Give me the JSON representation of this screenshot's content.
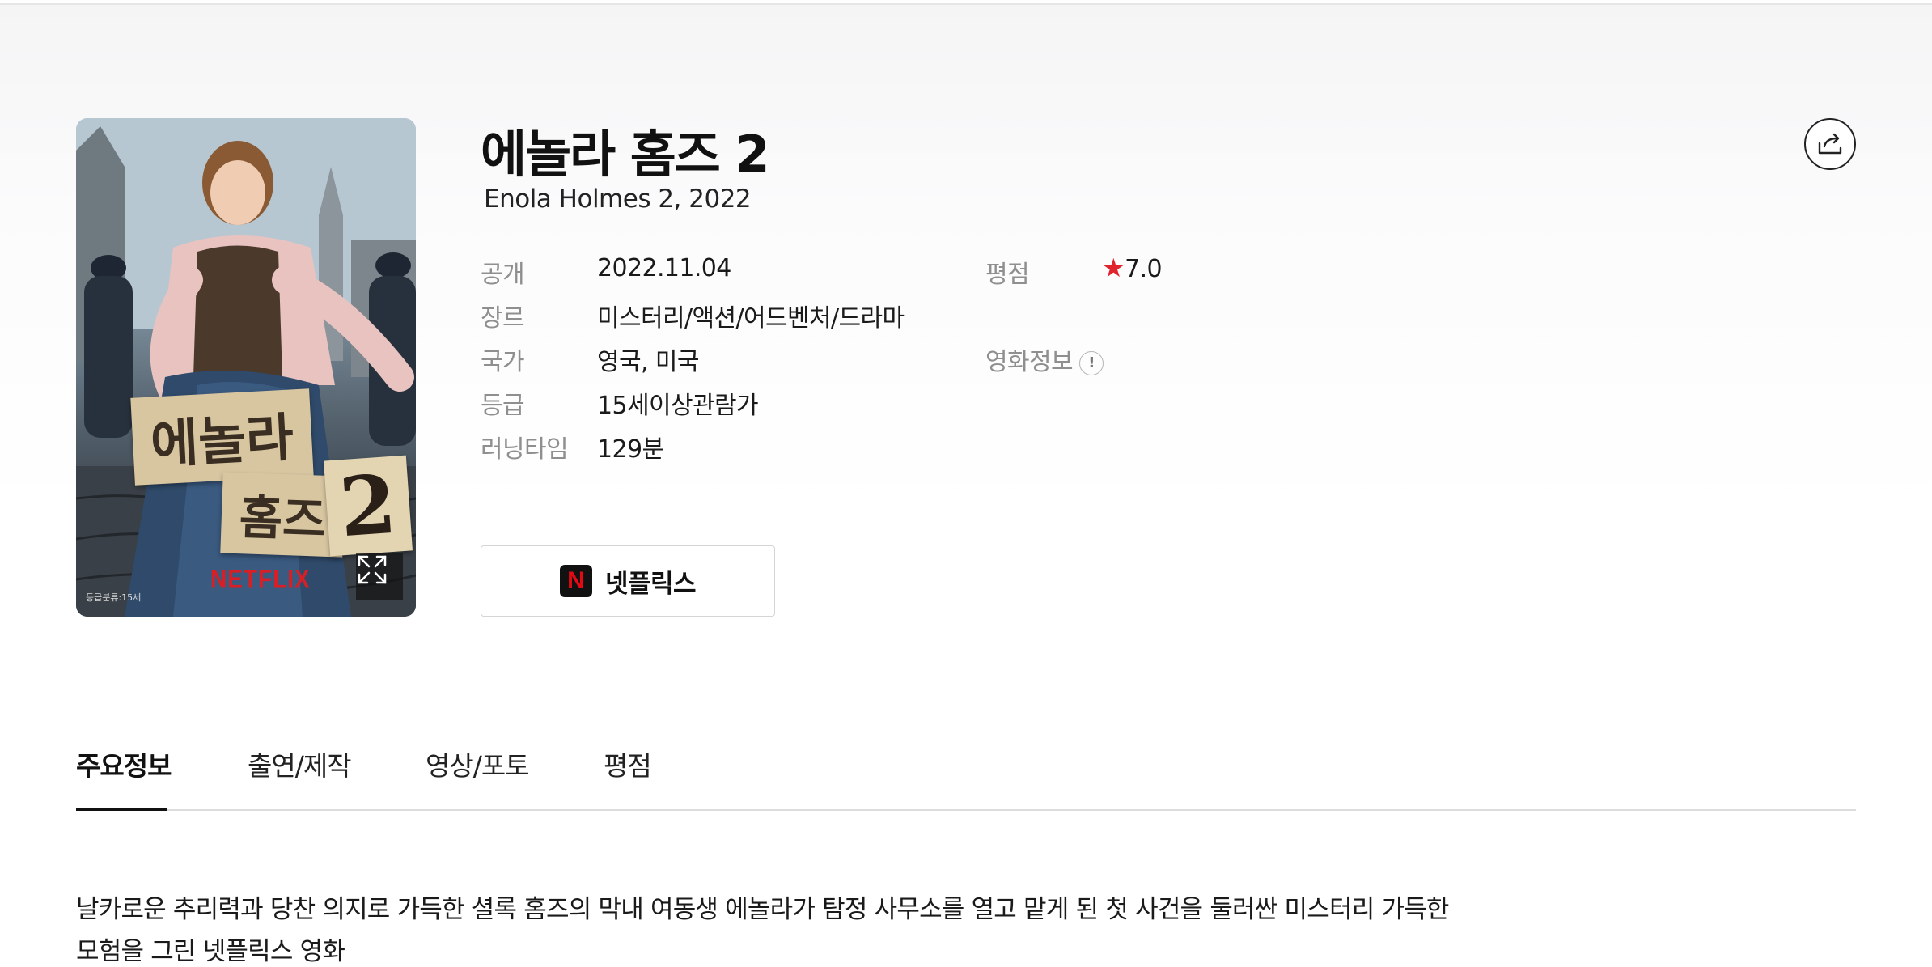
{
  "movie": {
    "title": "에놀라 홈즈 2",
    "subtitle": "Enola Holmes 2, 2022"
  },
  "poster": {
    "art_title_line1": "에놀라",
    "art_title_line2": "홈즈",
    "art_title_number": "2",
    "studio_mark": "NETFLIX",
    "rating_mark": "등급분류:15세",
    "expand_icon": "expand-icon"
  },
  "details": {
    "release_label": "공개",
    "release_value": "2022.11.04",
    "genre_label": "장르",
    "genre_value": "미스터리/액션/어드벤처/드라마",
    "country_label": "국가",
    "country_value": "영국, 미국",
    "grade_label": "등급",
    "grade_value": "15세이상관람가",
    "runtime_label": "러닝타임",
    "runtime_value": "129분",
    "score_label": "평점",
    "score_star": "★",
    "score_value": "7.0",
    "movieinfo_label": "영화정보",
    "movieinfo_badge": "!"
  },
  "watch": {
    "logo_letter": "N",
    "label": "넷플릭스"
  },
  "tabs": [
    {
      "label": "주요정보",
      "active": true
    },
    {
      "label": "출연/제작",
      "active": false
    },
    {
      "label": "영상/포토",
      "active": false
    },
    {
      "label": "평점",
      "active": false
    }
  ],
  "synopsis": "날카로운 추리력과 당찬 의지로 가득한 셜록 홈즈의 막내 여동생 에놀라가 탐정 사무소를 열고 맡게 된 첫 사건을 둘러싼 미스터리 가득한 모험을 그린 넷플릭스 영화",
  "colors": {
    "accent_star": "#e0242f",
    "netflix_red": "#e50914"
  },
  "icons": {
    "share": "share-icon",
    "info": "info-icon",
    "expand": "expand-icon"
  }
}
